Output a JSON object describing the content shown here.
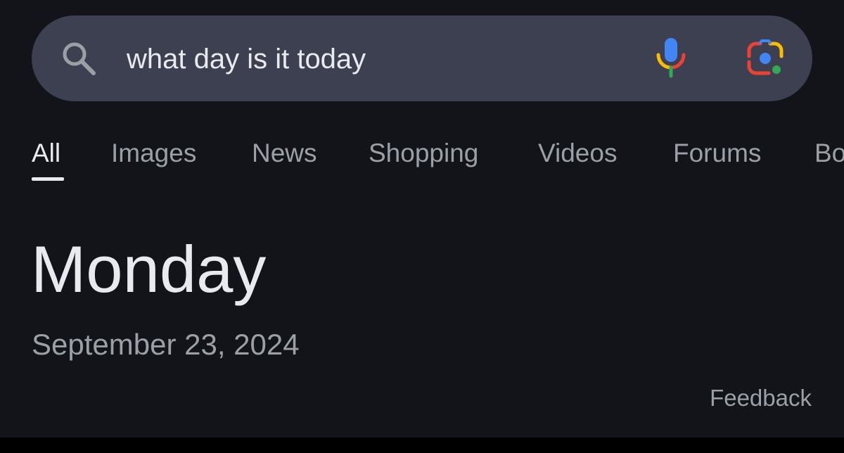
{
  "search": {
    "query": "what day is it today",
    "icons": {
      "search": "search-icon",
      "mic": "microphone-icon",
      "lens": "google-lens-icon"
    }
  },
  "tabs": [
    {
      "label": "All",
      "active": true
    },
    {
      "label": "Images",
      "active": false
    },
    {
      "label": "News",
      "active": false
    },
    {
      "label": "Shopping",
      "active": false
    },
    {
      "label": "Videos",
      "active": false
    },
    {
      "label": "Forums",
      "active": false
    },
    {
      "label": "Books",
      "active": false
    }
  ],
  "result": {
    "day": "Monday",
    "date": "September 23, 2024"
  },
  "feedback_label": "Feedback",
  "colors": {
    "background": "#131419",
    "search_bar": "#3d4050",
    "text_primary": "#e8eaed",
    "text_secondary": "#9aa0a6",
    "google_blue": "#4285f4",
    "google_red": "#ea4335",
    "google_yellow": "#fbbc04",
    "google_green": "#34a853"
  }
}
